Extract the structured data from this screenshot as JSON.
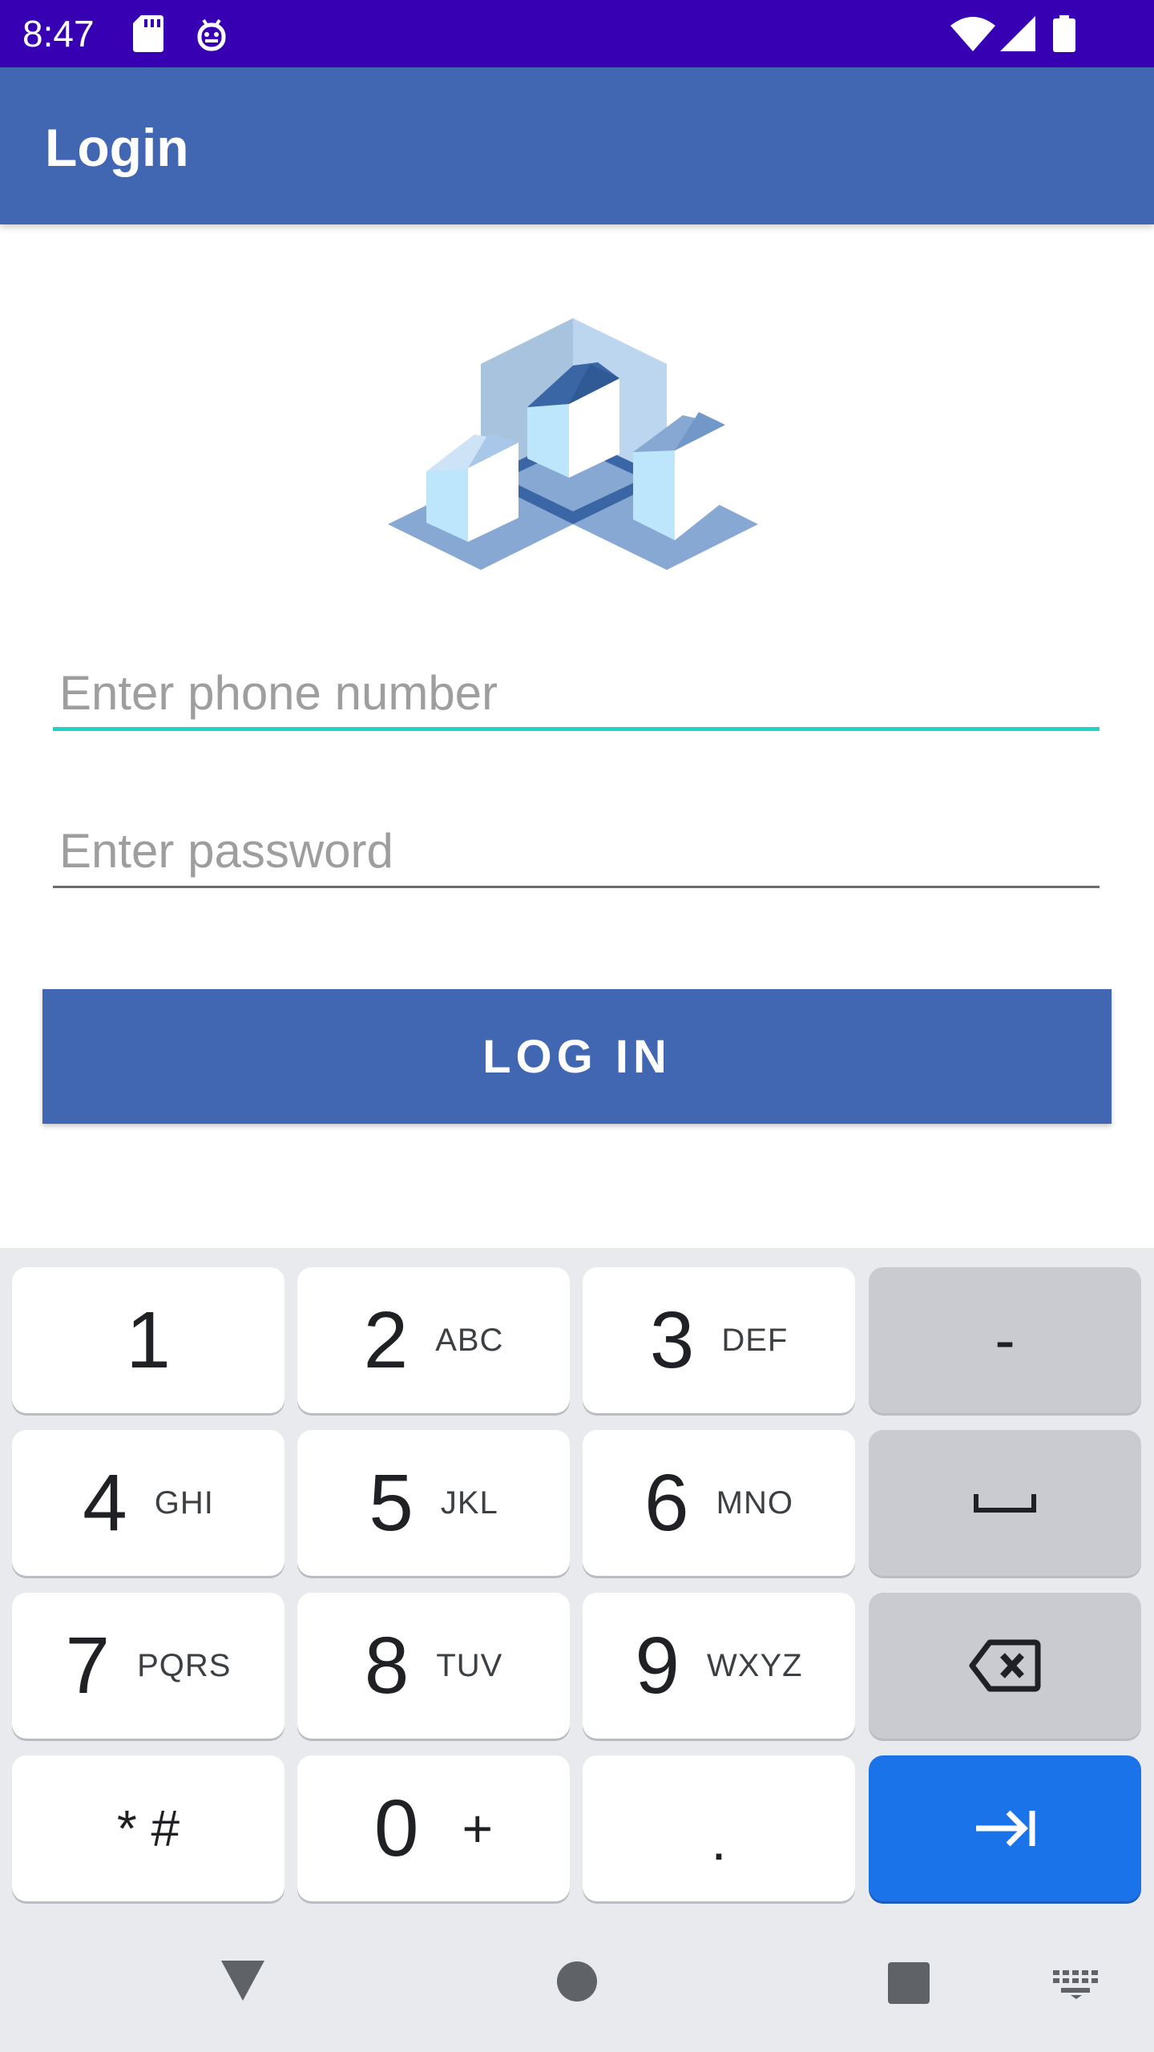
{
  "status_bar": {
    "time": "8:47",
    "icons": [
      "sd-card-icon",
      "debug-icon",
      "wifi-icon",
      "signal-icon",
      "battery-icon"
    ]
  },
  "app_bar": {
    "title": "Login"
  },
  "logo": {
    "icon": "houses-logo-icon"
  },
  "form": {
    "phone_placeholder": "Enter phone number",
    "password_placeholder": "Enter password",
    "login_label": "LOG IN"
  },
  "keyboard": {
    "keys": [
      {
        "digit": "1",
        "letters": ""
      },
      {
        "digit": "2",
        "letters": "ABC"
      },
      {
        "digit": "3",
        "letters": "DEF"
      },
      {
        "digit": "-",
        "letters": ""
      },
      {
        "digit": "4",
        "letters": "GHI"
      },
      {
        "digit": "5",
        "letters": "JKL"
      },
      {
        "digit": "6",
        "letters": "MNO"
      },
      {
        "digit": "space-bar-icon",
        "letters": ""
      },
      {
        "digit": "7",
        "letters": "PQRS"
      },
      {
        "digit": "8",
        "letters": "TUV"
      },
      {
        "digit": "9",
        "letters": "WXYZ"
      },
      {
        "digit": "backspace-icon",
        "letters": ""
      },
      {
        "digit": "* #",
        "letters": ""
      },
      {
        "digit": "0",
        "letters": "+"
      },
      {
        "digit": ".",
        "letters": ""
      },
      {
        "digit": "next-field-icon",
        "letters": ""
      }
    ]
  },
  "nav_bar": {
    "icons": [
      "back-icon",
      "home-icon",
      "recents-icon",
      "keyboard-switch-icon"
    ]
  },
  "colors": {
    "status_bar": "#3700b3",
    "primary": "#4267b2",
    "focus_underline": "#1fd3c6",
    "keyboard_bg": "#e8eaed",
    "action_key": "#1a73e8"
  }
}
